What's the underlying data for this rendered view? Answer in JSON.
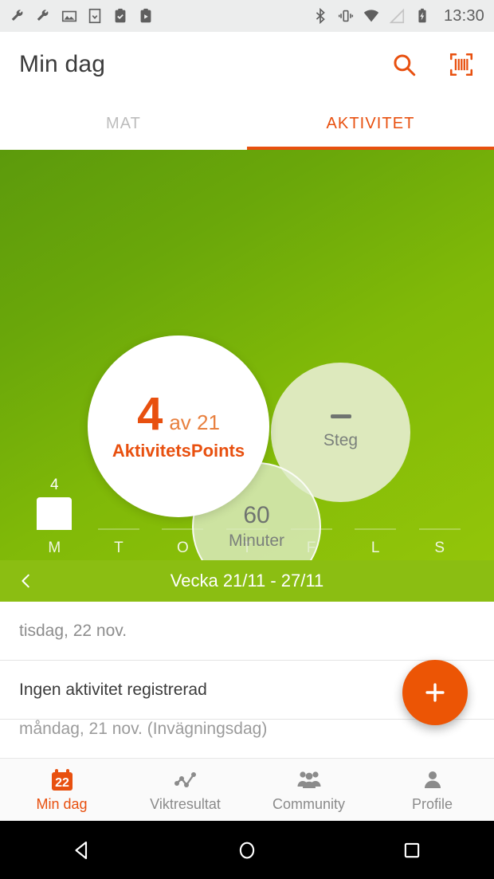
{
  "statusbar": {
    "time": "13:30",
    "left_icons": [
      "wrench-icon",
      "wrench-icon",
      "image-icon",
      "download-icon",
      "clipboard-check-icon",
      "clipboard-play-icon"
    ],
    "right_icons": [
      "bluetooth-icon",
      "vibrate-icon",
      "wifi-icon",
      "signal-icon",
      "battery-charging-icon"
    ]
  },
  "appbar": {
    "title": "Min dag",
    "search_icon": "search-icon",
    "barcode_icon": "barcode-scanner-icon"
  },
  "tabs": [
    {
      "label": "MAT",
      "active": false
    },
    {
      "label": "AKTIVITET",
      "active": true
    }
  ],
  "hero": {
    "points": {
      "value": "4",
      "of": "av 21",
      "label": "AktivitetsPoints"
    },
    "steps": {
      "value": "—",
      "label": "Steg"
    },
    "minutes": {
      "value": "60",
      "label": "Minuter"
    }
  },
  "chart_data": {
    "type": "bar",
    "title": "",
    "categories": [
      "M",
      "T",
      "O",
      "T",
      "F",
      "L",
      "S"
    ],
    "values": [
      4,
      0,
      0,
      0,
      0,
      0,
      0
    ],
    "value_labels": [
      "4",
      "",
      "",
      "",
      "",
      "",
      ""
    ],
    "xlabel": "",
    "ylabel": "",
    "ylim": [
      0,
      21
    ],
    "grid": false,
    "legend": "none",
    "bar_color": "#ffffff"
  },
  "weeknav": {
    "back_icon": "chevron-left-icon",
    "label": "Vecka 21/11 - 27/11"
  },
  "list": [
    {
      "kind": "date",
      "text": "tisdag, 22 nov."
    },
    {
      "kind": "entry",
      "text": "Ingen aktivitet registrerad"
    },
    {
      "kind": "date",
      "text": "måndag, 21 nov. (Invägningsdag)"
    }
  ],
  "fab": {
    "icon": "plus-icon",
    "label": "+"
  },
  "bottomnav": [
    {
      "label": "Min dag",
      "icon": "calendar-22-icon",
      "badge": "22",
      "active": true
    },
    {
      "label": "Viktresultat",
      "icon": "line-chart-icon",
      "active": false
    },
    {
      "label": "Community",
      "icon": "people-icon",
      "active": false
    },
    {
      "label": "Profile",
      "icon": "person-icon",
      "active": false
    }
  ],
  "androidnav": [
    {
      "name": "back-button",
      "icon": "triangle-back-icon"
    },
    {
      "name": "home-button",
      "icon": "circle-home-icon"
    },
    {
      "name": "recents-button",
      "icon": "square-recents-icon"
    }
  ],
  "colors": {
    "accent": "#e8500f",
    "fab": "#ec5505",
    "green_dark": "#5c9a0c",
    "green_light": "#93c509",
    "weeknav": "#8bbe12",
    "bubble_steps": "#dde9bd"
  }
}
